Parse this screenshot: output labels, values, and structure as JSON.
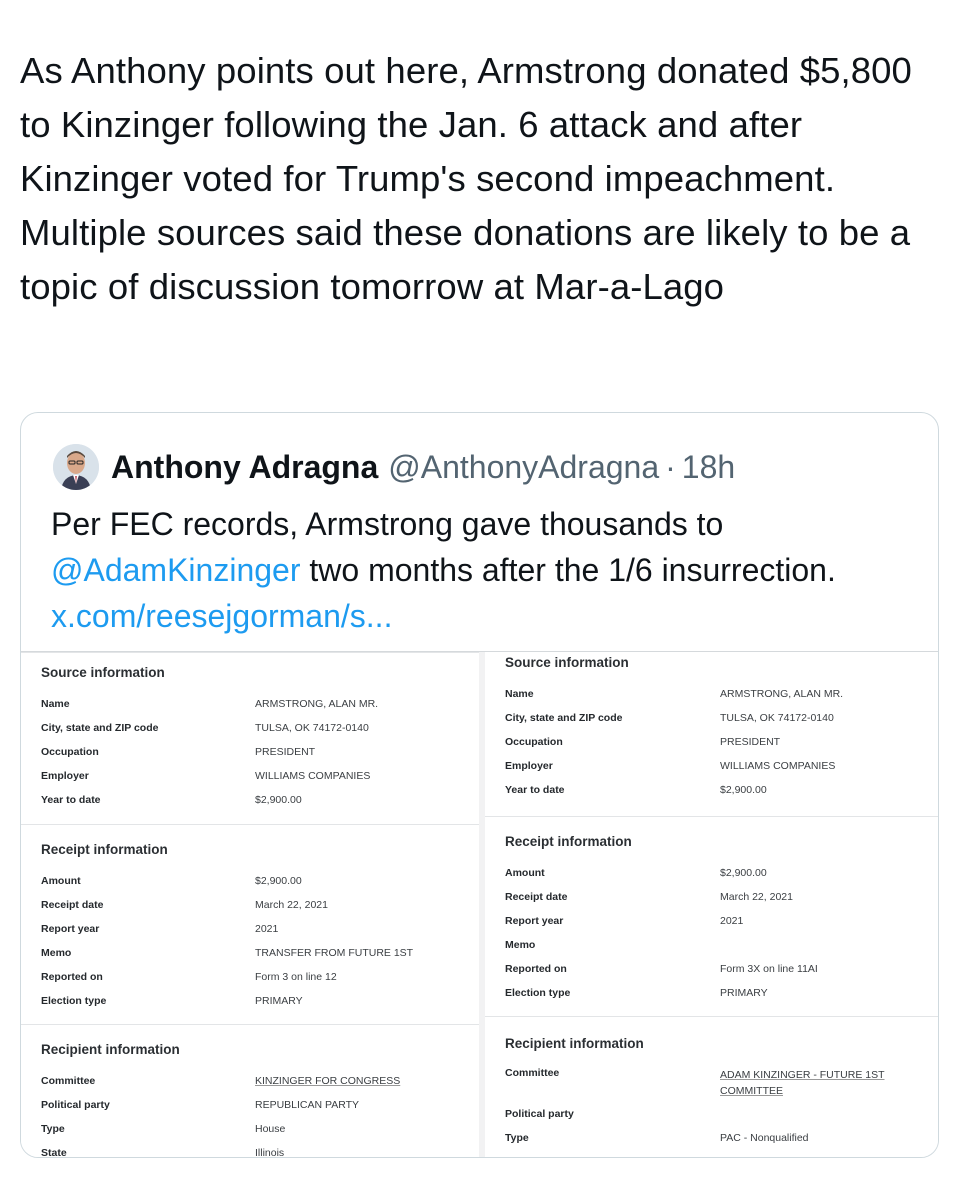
{
  "tweet": {
    "text": "As Anthony points out here, Armstrong donated $5,800 to Kinzinger following the Jan. 6 attack and after Kinzinger voted for Trump's second impeachment.  Multiple sources said these donations are likely to be a topic of discussion tomorrow at Mar-a-Lago"
  },
  "quote": {
    "name": "Anthony Adragna",
    "handle": "@AnthonyAdragna",
    "separator": "·",
    "time": "18h",
    "body_1": "Per FEC records, Armstrong gave thousands to",
    "mention": "@AdamKinzinger",
    "body_2": " two months after the 1/6 insurrection. ",
    "link": "x.com/reesejgorman/s..."
  },
  "left_record": {
    "source": {
      "title": "Source information",
      "rows": [
        {
          "label": "Name",
          "value": "ARMSTRONG, ALAN MR."
        },
        {
          "label": "City, state and ZIP code",
          "value": "TULSA, OK 74172-0140"
        },
        {
          "label": "Occupation",
          "value": "PRESIDENT"
        },
        {
          "label": "Employer",
          "value": "WILLIAMS COMPANIES"
        },
        {
          "label": "Year to date",
          "value": "$2,900.00"
        }
      ]
    },
    "receipt": {
      "title": "Receipt information",
      "rows": [
        {
          "label": "Amount",
          "value": "$2,900.00"
        },
        {
          "label": "Receipt date",
          "value": "March 22, 2021"
        },
        {
          "label": "Report year",
          "value": "2021"
        },
        {
          "label": "Memo",
          "value": "TRANSFER FROM FUTURE 1ST"
        },
        {
          "label": "Reported on",
          "value": "Form 3 on line 12"
        },
        {
          "label": "Election type",
          "value": "PRIMARY"
        }
      ]
    },
    "recipient": {
      "title": "Recipient information",
      "rows": [
        {
          "label": "Committee",
          "value": "KINZINGER FOR CONGRESS"
        },
        {
          "label": "Political party",
          "value": "REPUBLICAN PARTY"
        },
        {
          "label": "Type",
          "value": "House"
        },
        {
          "label": "State",
          "value": "Illinois"
        }
      ]
    }
  },
  "right_record": {
    "source": {
      "title": "Source information",
      "rows": [
        {
          "label": "Name",
          "value": "ARMSTRONG, ALAN MR."
        },
        {
          "label": "City, state and ZIP code",
          "value": "TULSA, OK 74172-0140"
        },
        {
          "label": "Occupation",
          "value": "PRESIDENT"
        },
        {
          "label": "Employer",
          "value": "WILLIAMS COMPANIES"
        },
        {
          "label": "Year to date",
          "value": "$2,900.00"
        }
      ]
    },
    "receipt": {
      "title": "Receipt information",
      "rows": [
        {
          "label": "Amount",
          "value": "$2,900.00"
        },
        {
          "label": "Receipt date",
          "value": "March 22, 2021"
        },
        {
          "label": "Report year",
          "value": "2021"
        },
        {
          "label": "Memo",
          "value": ""
        },
        {
          "label": "Reported on",
          "value": "Form 3X on line 11AI"
        },
        {
          "label": "Election type",
          "value": "PRIMARY"
        }
      ]
    },
    "recipient": {
      "title": "Recipient information",
      "rows": [
        {
          "label": "Committee",
          "value": "ADAM KINZINGER - FUTURE 1ST COMMITTEE"
        },
        {
          "label": "Political party",
          "value": ""
        },
        {
          "label": "Type",
          "value": "PAC - Nonqualified"
        }
      ]
    }
  }
}
